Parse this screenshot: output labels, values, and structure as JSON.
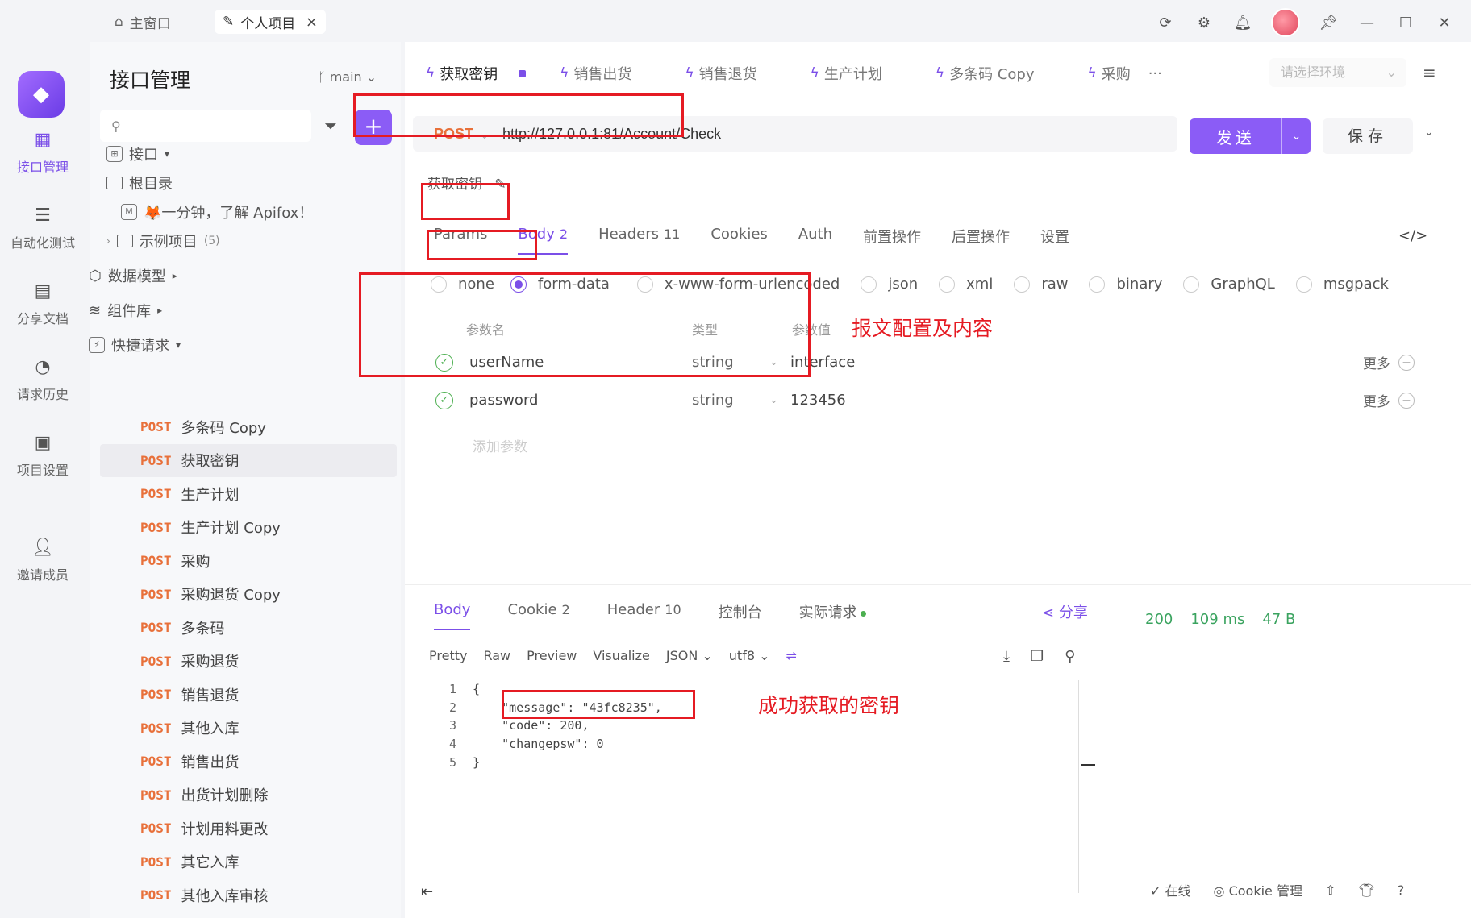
{
  "window": {
    "home_tab": "主窗口",
    "project_tab": "个人项目",
    "close_glyph": "×"
  },
  "rail": {
    "items": [
      "接口管理",
      "自动化测试",
      "分享文档",
      "请求历史",
      "项目设置",
      "邀请成员"
    ]
  },
  "sidebar": {
    "title": "接口管理",
    "branch": "main",
    "tree": {
      "interfaces": "接口",
      "root": "根目录",
      "intro": "🦊一分钟，了解 Apifox！",
      "examples": "示例项目",
      "examples_count": "(5)",
      "data_models": "数据模型",
      "components": "组件库",
      "quick_requests": "快捷请求"
    },
    "api_items": [
      {
        "method": "POST",
        "name": "多条码 Copy"
      },
      {
        "method": "POST",
        "name": "获取密钥"
      },
      {
        "method": "POST",
        "name": "生产计划"
      },
      {
        "method": "POST",
        "name": "生产计划 Copy"
      },
      {
        "method": "POST",
        "name": "采购"
      },
      {
        "method": "POST",
        "name": "采购退货 Copy"
      },
      {
        "method": "POST",
        "name": "多条码"
      },
      {
        "method": "POST",
        "name": "采购退货"
      },
      {
        "method": "POST",
        "name": "销售退货"
      },
      {
        "method": "POST",
        "name": "其他入库"
      },
      {
        "method": "POST",
        "name": "销售出货"
      },
      {
        "method": "POST",
        "name": "出货计划删除"
      },
      {
        "method": "POST",
        "name": "计划用料更改"
      },
      {
        "method": "POST",
        "name": "其它入库"
      },
      {
        "method": "POST",
        "name": "其他入库审核"
      }
    ]
  },
  "main": {
    "tabs": [
      "获取密钥",
      "销售出货",
      "销售退货",
      "生产计划",
      "多条码 Copy",
      "采购"
    ],
    "env_placeholder": "请选择环境",
    "method": "POST",
    "url": "http://127.0.0.1:81/Account/Check",
    "send_label": "发送",
    "save_label": "保存",
    "api_name": "获取密钥",
    "req_tabs": [
      {
        "label": "Params",
        "count": ""
      },
      {
        "label": "Body",
        "count": "2"
      },
      {
        "label": "Headers",
        "count": "11"
      },
      {
        "label": "Cookies",
        "count": ""
      },
      {
        "label": "Auth",
        "count": ""
      },
      {
        "label": "前置操作",
        "count": ""
      },
      {
        "label": "后置操作",
        "count": ""
      },
      {
        "label": "设置",
        "count": ""
      }
    ],
    "body_types": [
      "none",
      "form-data",
      "x-www-form-urlencoded",
      "json",
      "xml",
      "raw",
      "binary",
      "GraphQL",
      "msgpack"
    ],
    "param_headers": {
      "name": "参数名",
      "type": "类型",
      "value": "参数值"
    },
    "params": [
      {
        "name": "userName",
        "type": "string",
        "value": "interface",
        "more": "更多"
      },
      {
        "name": "password",
        "type": "string",
        "value": "123456",
        "more": "更多"
      }
    ],
    "add_param": "添加参数",
    "annotation_params": "报文配置及内容",
    "annotation_response": "成功获取的密钥"
  },
  "response": {
    "tabs": [
      {
        "label": "Body",
        "count": ""
      },
      {
        "label": "Cookie",
        "count": "2"
      },
      {
        "label": "Header",
        "count": "10"
      },
      {
        "label": "控制台",
        "count": ""
      },
      {
        "label": "实际请求",
        "count": ""
      }
    ],
    "share": "分享",
    "status": "200",
    "time": "109 ms",
    "size": "47 B",
    "formats": [
      "Pretty",
      "Raw",
      "Preview",
      "Visualize",
      "JSON",
      "utf8"
    ],
    "code_lines": [
      {
        "n": "1",
        "text": "{"
      },
      {
        "n": "2",
        "text": "    \"message\": \"43fc8235\","
      },
      {
        "n": "3",
        "text": "    \"code\": 200,"
      },
      {
        "n": "4",
        "text": "    \"changepsw\": 0"
      },
      {
        "n": "5",
        "text": "}"
      }
    ]
  },
  "footer": {
    "online": "在线",
    "cookie": "Cookie 管理"
  },
  "colors": {
    "accent": "#7b4fe8",
    "method": "#e8703a",
    "annotation": "#e51b23",
    "success": "#3aa35f"
  }
}
